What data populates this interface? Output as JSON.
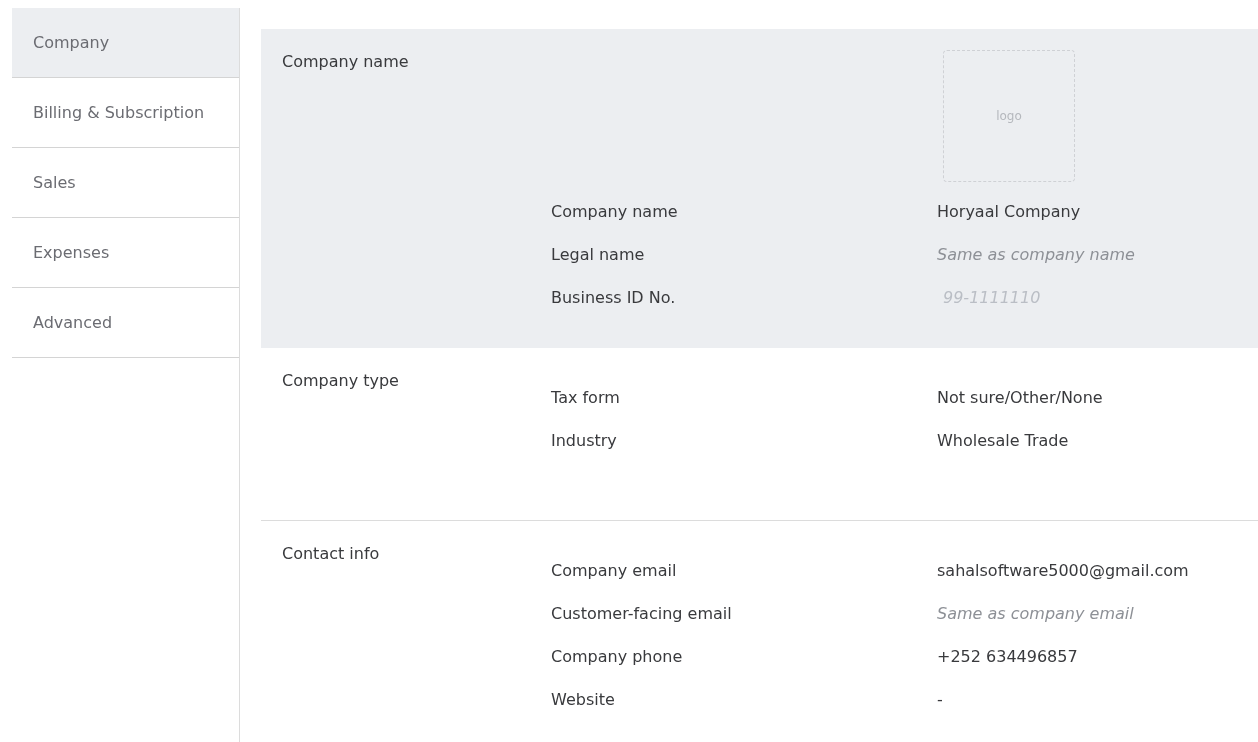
{
  "sidebar": {
    "items": [
      {
        "label": "Company",
        "selected": true
      },
      {
        "label": "Billing & Subscription",
        "selected": false
      },
      {
        "label": "Sales",
        "selected": false
      },
      {
        "label": "Expenses",
        "selected": false
      },
      {
        "label": "Advanced",
        "selected": false
      }
    ]
  },
  "sections": [
    {
      "title": "Company name",
      "highlighted": true,
      "logo": {
        "label": "logo"
      },
      "rows": [
        {
          "label": "Company name",
          "value": "Horyaal Company",
          "kind": "text"
        },
        {
          "label": "Legal name",
          "value": "Same as company name",
          "kind": "hint"
        },
        {
          "label": "Business ID No.",
          "value": "99-1111110",
          "kind": "faint"
        }
      ]
    },
    {
      "title": "Company type",
      "highlighted": false,
      "rows": [
        {
          "label": "Tax form",
          "value": "Not sure/Other/None",
          "kind": "text"
        },
        {
          "label": "Industry",
          "value": "Wholesale Trade",
          "kind": "text"
        }
      ]
    },
    {
      "title": "Contact info",
      "highlighted": false,
      "rows": [
        {
          "label": "Company email",
          "value": "sahalsoftware5000@gmail.com",
          "kind": "text"
        },
        {
          "label": "Customer-facing email",
          "value": "Same as company email",
          "kind": "hint"
        },
        {
          "label": "Company phone",
          "value": "+252 634496857",
          "kind": "text"
        },
        {
          "label": "Website",
          "value": "-",
          "kind": "text"
        }
      ]
    }
  ]
}
